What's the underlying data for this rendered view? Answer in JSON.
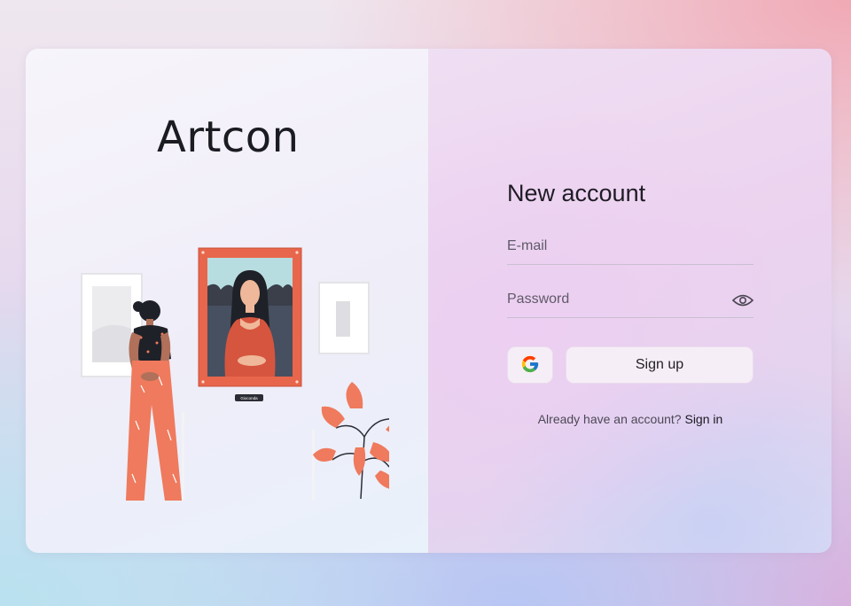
{
  "brand": {
    "name": "Artcon"
  },
  "illustration": {
    "plaque_text": "Gioconda"
  },
  "form": {
    "title": "New account",
    "email_placeholder": "E-mail",
    "password_placeholder": "Password",
    "signup_label": "Sign up",
    "google_icon": "google-icon",
    "eye_icon": "eye-icon",
    "signin_prompt": "Already have an account?",
    "signin_link": "Sign in"
  },
  "colors": {
    "frame": "#e8664b",
    "person_pants": "#ef7a5d",
    "plant_leaf": "#ef7a5d",
    "text_dark": "#1b1b22"
  }
}
